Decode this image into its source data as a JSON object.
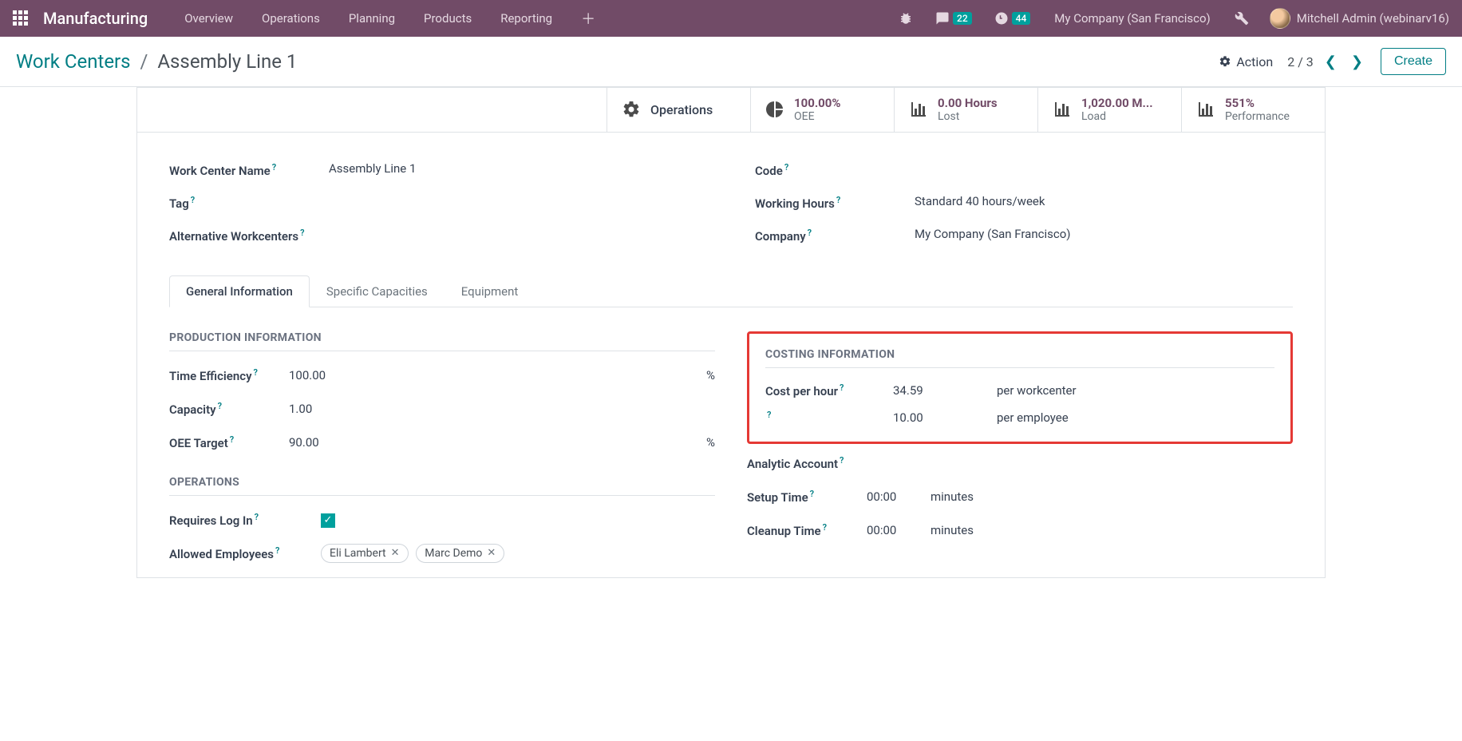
{
  "topnav": {
    "app": "Manufacturing",
    "menus": [
      "Overview",
      "Operations",
      "Planning",
      "Products",
      "Reporting"
    ],
    "messages_count": "22",
    "activities_count": "44",
    "company": "My Company (San Francisco)",
    "user": "Mitchell Admin (webinarv16)"
  },
  "breadcrumb": {
    "root": "Work Centers",
    "current": "Assembly Line 1"
  },
  "controls": {
    "action_label": "Action",
    "pager_current": "2",
    "pager_total": "3",
    "create_label": "Create"
  },
  "stats": {
    "operations": {
      "label": "Operations"
    },
    "oee": {
      "value": "100.00%",
      "label": "OEE"
    },
    "lost": {
      "value": "0.00 Hours",
      "label": "Lost"
    },
    "load": {
      "value": "1,020.00 M...",
      "label": "Load"
    },
    "performance": {
      "value": "551%",
      "label": "Performance"
    }
  },
  "fields": {
    "name_label": "Work Center Name",
    "name_value": "Assembly Line 1",
    "tag_label": "Tag",
    "tag_value": "",
    "alt_label": "Alternative Workcenters",
    "alt_value": "",
    "code_label": "Code",
    "code_value": "",
    "hours_label": "Working Hours",
    "hours_value": "Standard 40 hours/week",
    "company_label": "Company",
    "company_value": "My Company (San Francisco)"
  },
  "tabs": {
    "general": "General Information",
    "capacities": "Specific Capacities",
    "equipment": "Equipment"
  },
  "general": {
    "production_header": "PRODUCTION INFORMATION",
    "time_eff_label": "Time Efficiency",
    "time_eff_value": "100.00",
    "capacity_label": "Capacity",
    "capacity_value": "1.00",
    "oee_target_label": "OEE Target",
    "oee_target_value": "90.00",
    "percent_suffix": "%",
    "operations_header": "OPERATIONS",
    "requires_login_label": "Requires Log In",
    "allowed_employees_label": "Allowed Employees",
    "employees": [
      "Eli Lambert",
      "Marc Demo"
    ],
    "costing_header": "COSTING INFORMATION",
    "cost_per_hour_label": "Cost per hour",
    "cost_per_hour_value": "34.59",
    "cost_per_hour_unit": "per workcenter",
    "cost_employee_value": "10.00",
    "cost_employee_unit": "per employee",
    "analytic_label": "Analytic Account",
    "analytic_value": "",
    "setup_label": "Setup Time",
    "setup_value": "00:00",
    "cleanup_label": "Cleanup Time",
    "cleanup_value": "00:00",
    "minutes_label": "minutes"
  }
}
